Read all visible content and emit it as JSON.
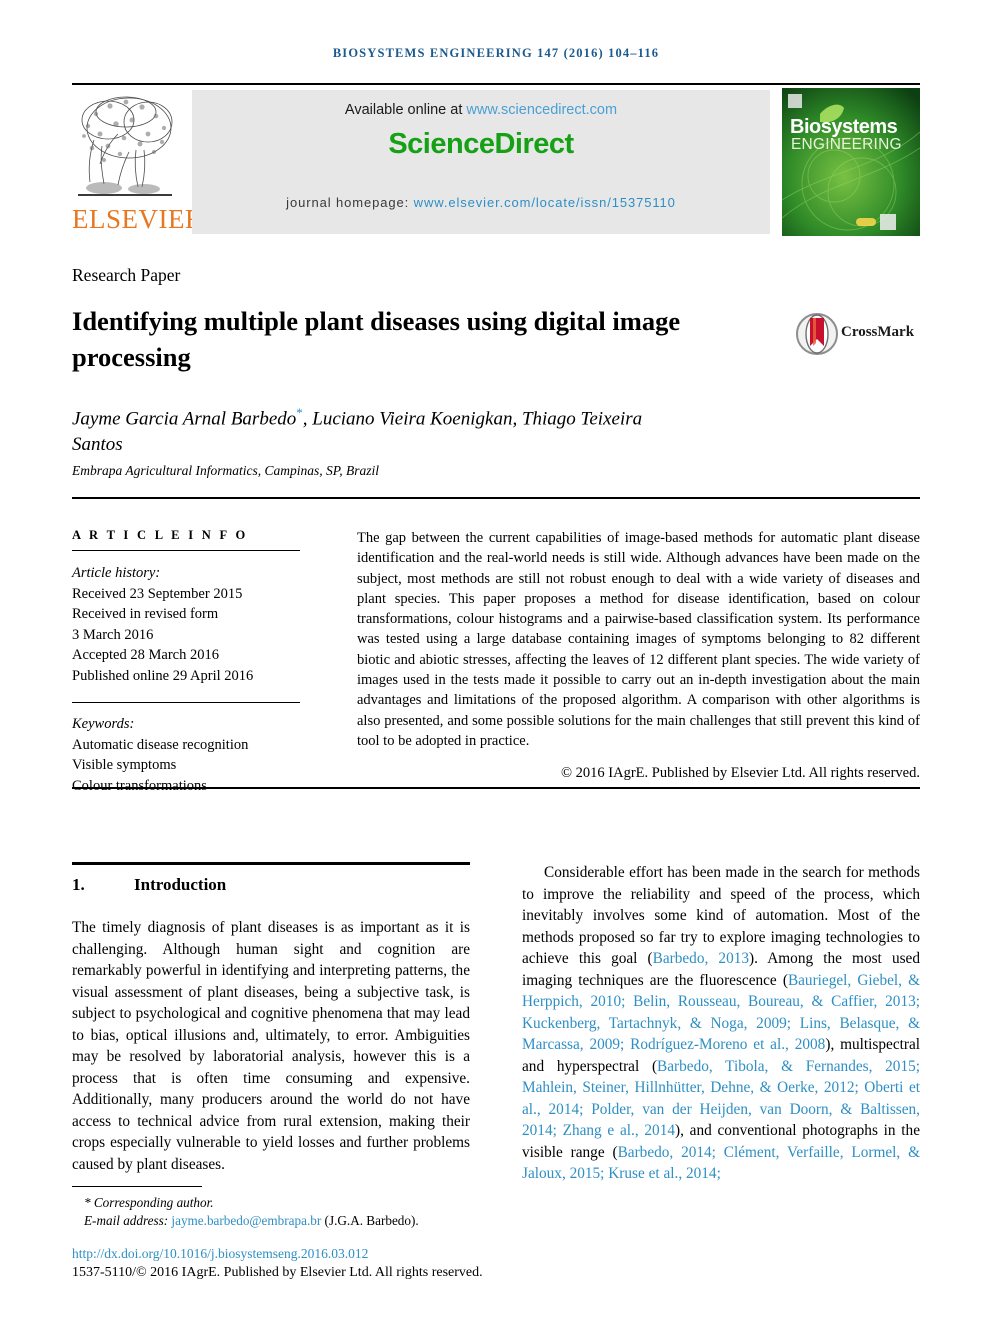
{
  "running_head": "BIOSYSTEMS ENGINEERING 147 (2016) 104–116",
  "masthead": {
    "publisher_name": "ELSEVIER",
    "available_prefix": "Available online at ",
    "available_link": "www.sciencedirect.com",
    "sciencedirect_logo": "ScienceDirect",
    "homepage_prefix": "journal homepage: ",
    "homepage_link": "www.elsevier.com/locate/issn/15375110",
    "cover": {
      "title_line1": "Biosystems",
      "title_line2": "ENGINEERING"
    },
    "colors": {
      "elsevier_orange": "#e87722",
      "sciencedirect_green": "#16a016",
      "link_blue": "#2e8fc4",
      "banner_grey": "#e7e7e7"
    }
  },
  "article": {
    "type": "Research Paper",
    "title": "Identifying multiple plant diseases using digital image processing",
    "crossmark_label": "CrossMark",
    "authors": "Jayme Garcia Arnal Barbedo",
    "authors_rest": ", Luciano Vieira Koenigkan, Thiago Teixeira Santos",
    "corresponding_marker": "*",
    "affiliation": "Embrapa Agricultural Informatics, Campinas, SP, Brazil"
  },
  "info": {
    "heading": "A R T I C L E   I N F O",
    "history_label": "Article history:",
    "history": [
      "Received 23 September 2015",
      "Received in revised form",
      "3 March 2016",
      "Accepted 28 March 2016",
      "Published online 29 April 2016"
    ],
    "keywords_label": "Keywords:",
    "keywords": [
      "Automatic disease recognition",
      "Visible symptoms",
      "Colour transformations"
    ]
  },
  "abstract": {
    "text": "The gap between the current capabilities of image-based methods for automatic plant disease identification and the real-world needs is still wide. Although advances have been made on the subject, most methods are still not robust enough to deal with a wide variety of diseases and plant species. This paper proposes a method for disease identification, based on colour transformations, colour histograms and a pairwise-based classification system. Its performance was tested using a large database containing images of symptoms belonging to 82 different biotic and abiotic stresses, affecting the leaves of 12 different plant species. The wide variety of images used in the tests made it possible to carry out an in-depth investigation about the main advantages and limitations of the proposed algorithm. A comparison with other algorithms is also presented, and some possible solutions for the main challenges that still prevent this kind of tool to be adopted in practice.",
    "copyright": "© 2016 IAgrE. Published by Elsevier Ltd. All rights reserved."
  },
  "body": {
    "section_number": "1.",
    "section_title": "Introduction",
    "paragraph_left": "The timely diagnosis of plant diseases is as important as it is challenging. Although human sight and cognition are remarkably powerful in identifying and interpreting patterns, the visual assessment of plant diseases, being a subjective task, is subject to psychological and cognitive phenomena that may lead to bias, optical illusions and, ultimately, to error. Ambiguities may be resolved by laboratorial analysis, however this is a process that is often time consuming and expensive. Additionally, many producers around the world do not have access to technical advice from rural extension, making their crops especially vulnerable to yield losses and further problems caused by plant diseases.",
    "paragraph_right_1": "Considerable effort has been made in the search for methods to improve the reliability and speed of the process, which inevitably involves some kind of automation. Most of the methods proposed so far try to explore imaging technologies to achieve this goal (",
    "ref_1": "Barbedo, 2013",
    "paragraph_right_2": "). Among the most used imaging techniques are the fluorescence (",
    "ref_2": "Bauriegel, Giebel, & Herppich, 2010; Belin, Rousseau, Boureau, & Caffier, 2013; Kuckenberg, Tartachnyk, & Noga, 2009; Lins, Belasque, & Marcassa, 2009; Rodríguez-Moreno et al., 2008",
    "paragraph_right_3": "), multispectral and hyperspectral (",
    "ref_3": "Barbedo, Tibola, & Fernandes, 2015; Mahlein, Steiner, Hillnhütter, Dehne, & Oerke, 2012; Oberti et al., 2014; Polder, van der Heijden, van Doorn, & Baltissen, 2014; Zhang e al., 2014",
    "paragraph_right_4": "), and conventional photographs in the visible range (",
    "ref_4": "Barbedo, 2014; Clément, Verfaille, Lormel, & Jaloux, 2015; Kruse et al., 2014;"
  },
  "footer": {
    "corresponding_marker": "*",
    "corresponding_label": "Corresponding author.",
    "email_label": "E-mail address: ",
    "email": "jayme.barbedo@embrapa.br",
    "email_owner": " (J.G.A. Barbedo).",
    "doi": "http://dx.doi.org/10.1016/j.biosystemseng.2016.03.012",
    "issn_line": "1537-5110/© 2016 IAgrE. Published by Elsevier Ltd. All rights reserved."
  }
}
